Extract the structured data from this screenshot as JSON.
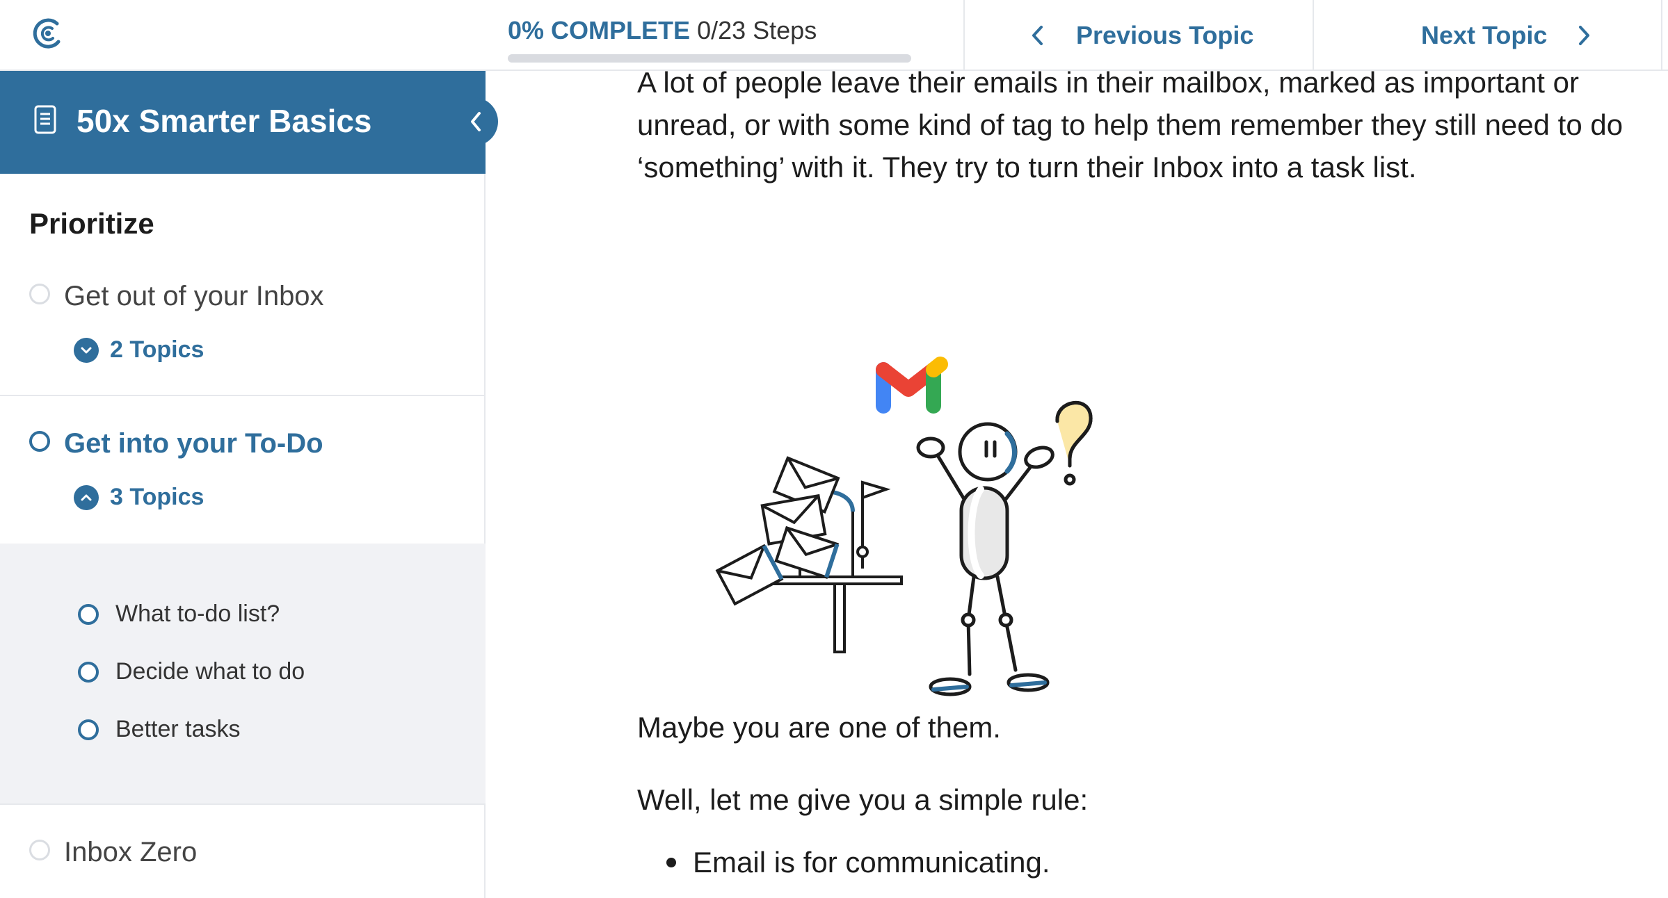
{
  "header": {
    "progress_percent_label": "0% COMPLETE",
    "progress_steps_label": "0/23 Steps",
    "progress_fraction": 0,
    "previous_label": "Previous Topic",
    "next_label": "Next Topic"
  },
  "sidebar": {
    "course_title": "50x Smarter Basics",
    "section_heading": "Prioritize",
    "lessons": [
      {
        "title": "Get out of your Inbox",
        "topics_label": "2 Topics",
        "expanded": false
      },
      {
        "title": "Get into your To-Do",
        "topics_label": "3 Topics",
        "expanded": true,
        "topics": [
          "What to-do list?",
          "Decide what to do",
          "Better tasks"
        ]
      },
      {
        "title": "Inbox Zero"
      }
    ]
  },
  "content": {
    "intro_paragraph": "A lot of people leave their emails in their mailbox, marked as important or unread, or with some kind of tag to help them remember they still need to do ‘something’ with it. They try to turn their Inbox into a task list.",
    "paragraph_2": "Maybe you are one of them.",
    "paragraph_3": "Well, let me give you a simple rule:",
    "bullets": [
      "Email is for communicating."
    ]
  },
  "colors": {
    "accent": "#2f6e9c",
    "gmail_red": "#ea4335",
    "gmail_blue": "#4285f4",
    "gmail_green": "#34a853",
    "gmail_yellow": "#fbbc04"
  }
}
